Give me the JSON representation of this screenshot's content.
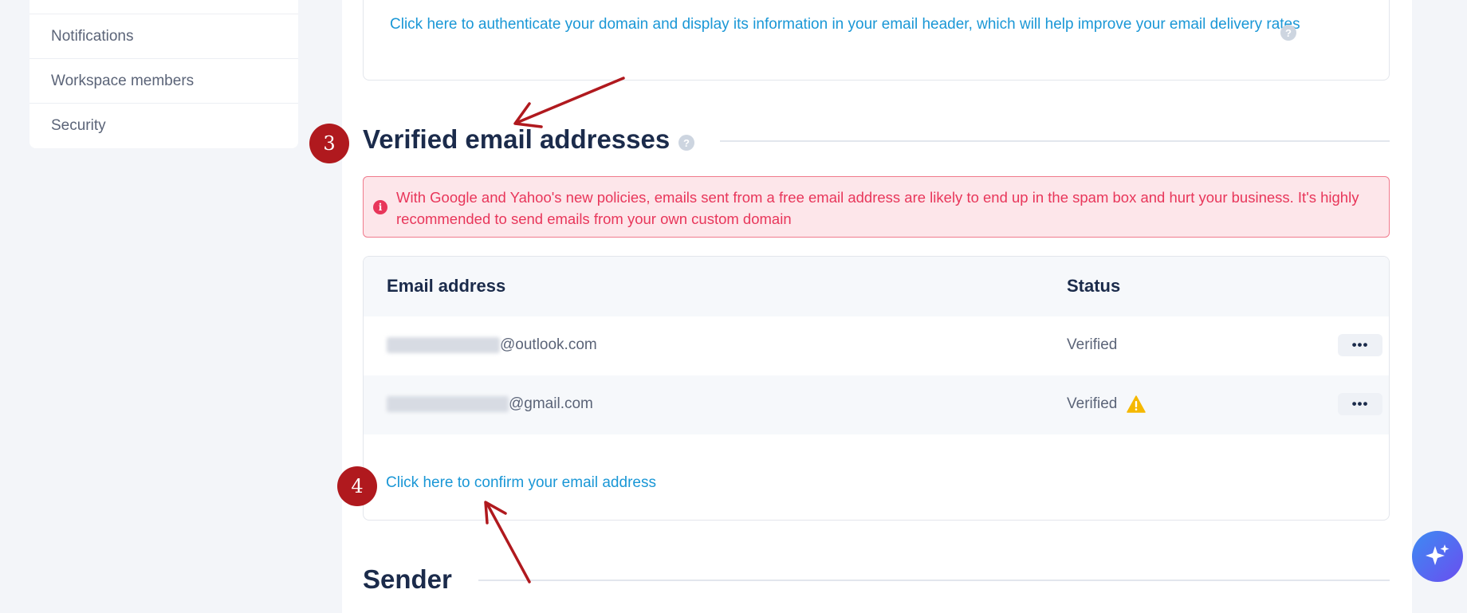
{
  "sidebar": {
    "items": [
      {
        "label": ""
      },
      {
        "label": "Notifications"
      },
      {
        "label": "Workspace members"
      },
      {
        "label": "Security"
      }
    ]
  },
  "auth_card": {
    "link_text": "Click here to authenticate your domain and display its information in your email header, which will help improve your email delivery rates",
    "help_icon": "question-icon"
  },
  "verified_section": {
    "step_number": "3",
    "title": "Verified email addresses",
    "help_icon": "question-icon",
    "alert": {
      "icon": "info-icon",
      "text": "With Google and Yahoo's new policies, emails sent from a free email address are likely to end up in the spam box and hurt your business. It's highly recommended to send emails from your own custom domain",
      "color": "#e8365a"
    },
    "table": {
      "columns": [
        "Email address",
        "Status"
      ],
      "rows": [
        {
          "email_domain": "@outlook.com",
          "status": "Verified",
          "warning": false,
          "menu": "•••"
        },
        {
          "email_domain": "@gmail.com",
          "status": "Verified",
          "warning": true,
          "menu": "•••"
        }
      ]
    },
    "confirm_step_number": "4",
    "confirm_link": "Click here to confirm your email address"
  },
  "sender_section": {
    "title": "Sender"
  },
  "colors": {
    "accent": "#1a97d6",
    "heading": "#1b2b4b",
    "annotation": "#b0191e",
    "warning": "#f5b800"
  },
  "fab": {
    "icon": "sparkle-icon"
  }
}
